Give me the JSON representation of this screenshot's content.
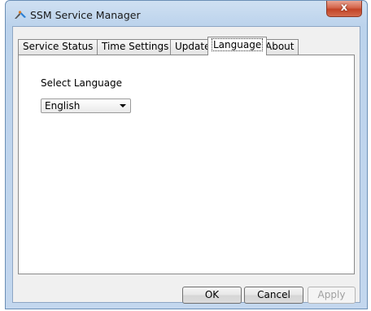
{
  "window": {
    "title": "SSM Service Manager",
    "close_label": "x"
  },
  "tabs": [
    {
      "label": "Service Status"
    },
    {
      "label": "Time Settings"
    },
    {
      "label": "Update"
    },
    {
      "label": "Language"
    },
    {
      "label": "About"
    }
  ],
  "active_tab": "Language",
  "language_panel": {
    "label": "Select Language",
    "selected": "English"
  },
  "buttons": {
    "ok": "OK",
    "cancel": "Cancel",
    "apply": "Apply"
  }
}
